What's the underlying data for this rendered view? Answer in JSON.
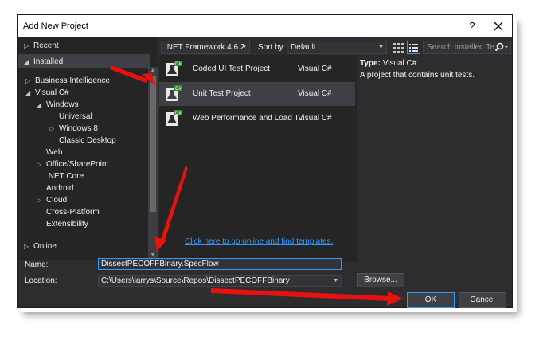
{
  "window": {
    "title": "Add New Project",
    "help_glyph": "?"
  },
  "tree": {
    "recent": "Recent",
    "installed": "Installed",
    "items": [
      {
        "label": "Business Intelligence",
        "tri": "▷"
      },
      {
        "label": "Visual C#",
        "tri": "◢"
      },
      {
        "label": "Windows",
        "tri": "◢"
      },
      {
        "label": "Universal",
        "tri": ""
      },
      {
        "label": "Windows 8",
        "tri": "▷"
      },
      {
        "label": "Classic Desktop",
        "tri": ""
      },
      {
        "label": "Web",
        "tri": ""
      },
      {
        "label": "Office/SharePoint",
        "tri": "▷"
      },
      {
        "label": ".NET Core",
        "tri": ""
      },
      {
        "label": "Android",
        "tri": ""
      },
      {
        "label": "Cloud",
        "tri": "▷"
      },
      {
        "label": "Cross-Platform",
        "tri": ""
      },
      {
        "label": "Extensibility",
        "tri": ""
      }
    ],
    "online": "Online"
  },
  "toolbar": {
    "framework": ".NET Framework 4.6.2",
    "sort_label": "Sort by:",
    "sort_value": "Default",
    "search_placeholder": "Search Installed Te"
  },
  "templates": [
    {
      "name": "Coded UI Test Project",
      "lang": "Visual C#",
      "selected": false
    },
    {
      "name": "Unit Test Project",
      "lang": "Visual C#",
      "selected": true
    },
    {
      "name": "Web Performance and Load T...",
      "lang": "Visual C#",
      "selected": false
    }
  ],
  "details": {
    "type_label": "Type:",
    "type_value": "Visual C#",
    "description": "A project that contains unit tests."
  },
  "online_link": "Click here to go online and find templates.",
  "form": {
    "name_label": "Name:",
    "name_value": "DissectPECOFFBinary.SpecFlow",
    "location_label": "Location:",
    "location_value": "C:\\Users\\larrys\\Source\\Repos\\DissectPECOFFBinary",
    "browse_label": "Browse...",
    "ok_label": "OK",
    "cancel_label": "Cancel"
  },
  "colors": {
    "accent": "#3399ff",
    "dialog_bg": "#2d2d30",
    "pane_bg": "#252526",
    "annotation_arrow": "#e8110f"
  }
}
